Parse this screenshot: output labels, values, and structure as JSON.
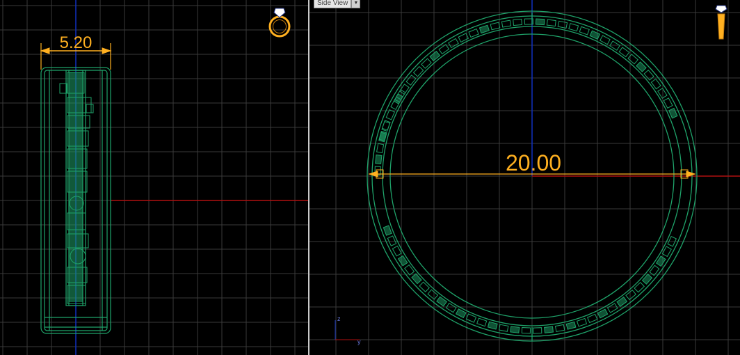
{
  "viewports": {
    "left": {
      "dimension_label": "5.20"
    },
    "right": {
      "view_name": "Side View",
      "dimension_label": "20.00",
      "axis_labels": {
        "z": "z",
        "y": "y"
      }
    }
  },
  "colors": {
    "background": "#000000",
    "grid": "#3a3a3a",
    "model_wireframe": "#1fa36a",
    "dimension": "#ffb020",
    "axis_x": "#b01010",
    "axis_y": "#1030c0",
    "splitter": "#c8c8c8"
  },
  "icons": {
    "left_nav": "ring-icon",
    "right_nav": "pendant-icon",
    "view_dropdown": "chevron-down-icon"
  }
}
